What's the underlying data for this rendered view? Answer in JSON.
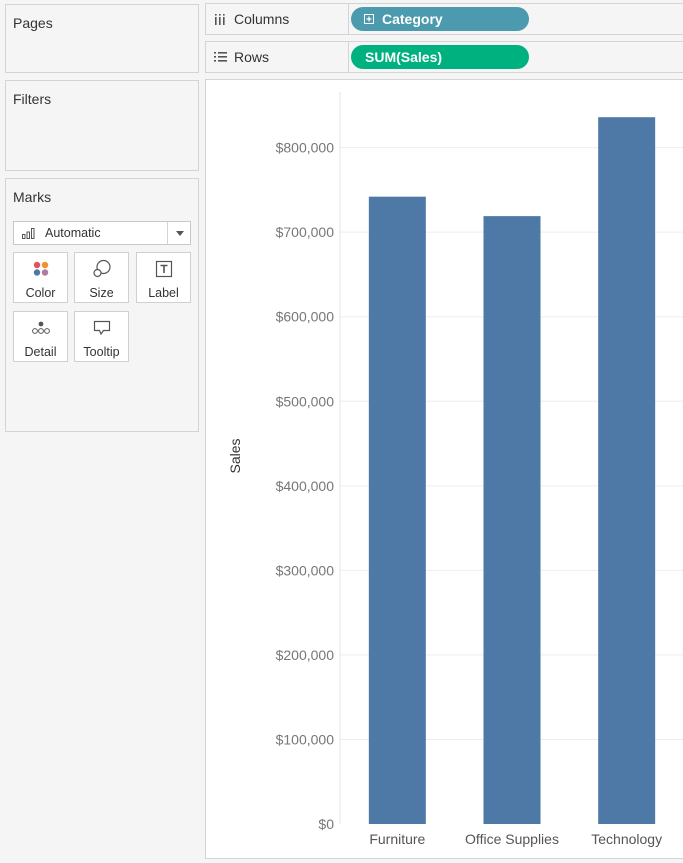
{
  "pages": {
    "title": "Pages"
  },
  "filters": {
    "title": "Filters"
  },
  "marks": {
    "title": "Marks",
    "mark_type": "Automatic",
    "buttons": [
      "Color",
      "Size",
      "Label",
      "Detail",
      "Tooltip"
    ]
  },
  "shelves": {
    "columns": {
      "label": "Columns",
      "pill": "Category"
    },
    "rows": {
      "label": "Rows",
      "pill": "SUM(Sales)"
    }
  },
  "colors": {
    "bar": "#4e79a7",
    "columns_pill": "#4b9aae",
    "rows_pill": "#00b180"
  },
  "chart_data": {
    "type": "bar",
    "categories": [
      "Furniture",
      "Office Supplies",
      "Technology"
    ],
    "values": [
      742000,
      719000,
      836000
    ],
    "ylabel": "Sales",
    "ylim": [
      0,
      880000
    ],
    "yticks": [
      {
        "value": 0,
        "label": "$0"
      },
      {
        "value": 100000,
        "label": "$100,000"
      },
      {
        "value": 200000,
        "label": "$200,000"
      },
      {
        "value": 300000,
        "label": "$300,000"
      },
      {
        "value": 400000,
        "label": "$400,000"
      },
      {
        "value": 500000,
        "label": "$500,000"
      },
      {
        "value": 600000,
        "label": "$600,000"
      },
      {
        "value": 700000,
        "label": "$700,000"
      },
      {
        "value": 800000,
        "label": "$800,000"
      }
    ],
    "grid": true
  }
}
